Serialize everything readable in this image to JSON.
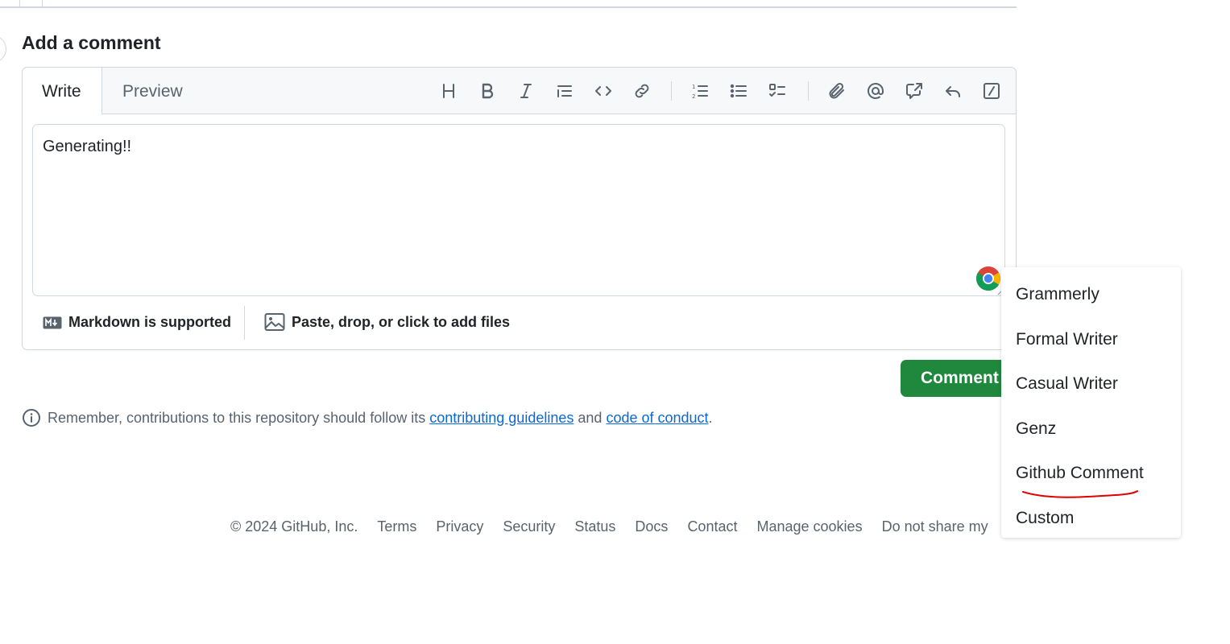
{
  "heading": "Add a comment",
  "tabs": {
    "write": "Write",
    "preview": "Preview"
  },
  "toolbar": {
    "icons": [
      "heading-icon",
      "bold-icon",
      "italic-icon",
      "quote-icon",
      "code-icon",
      "link-icon",
      "numbered-list-icon",
      "unordered-list-icon",
      "task-list-icon",
      "attach-icon",
      "mention-icon",
      "cross-reference-icon",
      "saved-reply-icon",
      "slash-commands-icon"
    ]
  },
  "textarea": {
    "value": "Generating!!"
  },
  "footer_notes": {
    "markdown": "Markdown is supported",
    "files": "Paste, drop, or click to add files"
  },
  "actions": {
    "comment": "Comment"
  },
  "remember": {
    "prefix": "Remember, contributions to this repository should follow its",
    "link1": "contributing guidelines",
    "middle": "and",
    "link2": "code of conduct",
    "suffix": "."
  },
  "page_footer": {
    "copyright": "© 2024 GitHub, Inc.",
    "links": [
      "Terms",
      "Privacy",
      "Security",
      "Status",
      "Docs",
      "Contact",
      "Manage cookies",
      "Do not share my"
    ]
  },
  "extension_menu": {
    "items": [
      "Grammerly",
      "Formal Writer",
      "Casual Writer",
      "Genz",
      "Github Comment",
      "Custom"
    ],
    "highlight_color": "#e00000"
  },
  "colors": {
    "accent_green": "#1f883d",
    "link": "#0969da",
    "muted": "#59636e"
  }
}
